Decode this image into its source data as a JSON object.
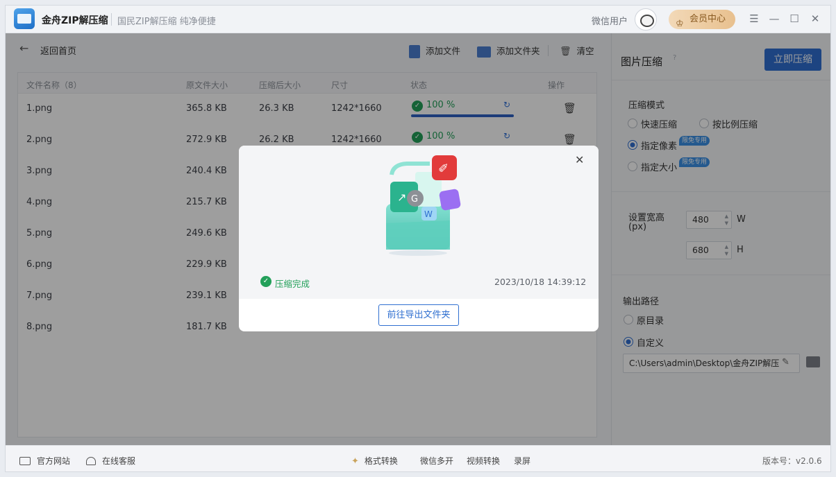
{
  "app": {
    "title": "金舟ZIP解压缩",
    "subtitle": "国民ZIP解压缩  纯净便捷",
    "user_name": "微信用户",
    "vip_label": "会员中心"
  },
  "window_controls": {
    "menu": "☰",
    "minimize": "—",
    "maximize": "☐",
    "close": "✕"
  },
  "toolbar": {
    "back_label": "返回首页",
    "add_file": "添加文件",
    "add_folder": "添加文件夹",
    "clear": "清空"
  },
  "table": {
    "headers": [
      "文件名称（8）",
      "原文件大小",
      "压缩后大小",
      "尺寸",
      "状态",
      "操作"
    ],
    "rows": [
      {
        "name": "1.png",
        "orig": "365.8 KB",
        "comp": "26.3 KB",
        "dim": "1242*1660",
        "progress": 1.0,
        "pct_text": "100 %"
      },
      {
        "name": "2.png",
        "orig": "272.9 KB",
        "comp": "26.2 KB",
        "dim": "1242*1660",
        "progress": 1.0,
        "pct_text": "100 %"
      },
      {
        "name": "3.png",
        "orig": "240.4 KB"
      },
      {
        "name": "4.png",
        "orig": "215.7 KB"
      },
      {
        "name": "5.png",
        "orig": "249.6 KB"
      },
      {
        "name": "6.png",
        "orig": "229.9 KB"
      },
      {
        "name": "7.png",
        "orig": "239.1 KB"
      },
      {
        "name": "8.png",
        "orig": "181.7 KB"
      }
    ]
  },
  "settings": {
    "title": "图片压缩",
    "help": "?",
    "compress_button": "立即压缩",
    "mode_label": "压缩模式",
    "mode_options": [
      "快速压缩",
      "按比例压缩",
      "指定像素",
      "指定大小"
    ],
    "mode_selected": "指定像素",
    "vip_badge": "限免专用",
    "size_label_1": "设置宽高",
    "size_label_2": "(px)",
    "width": "480",
    "height": "680",
    "width_unit": "W",
    "height_unit": "H",
    "output_label": "输出路径",
    "output_options": [
      "原目录",
      "自定义"
    ],
    "output_selected": "自定义",
    "output_path": "C:\\Users\\admin\\Desktop\\金舟ZIP解压"
  },
  "modal": {
    "status_text": "压缩完成",
    "timestamp": "2023/10/18 14:39:12",
    "open_folder_button": "前往导出文件夹",
    "close": "✕"
  },
  "footer": {
    "website": "官方网站",
    "support": "在线客服",
    "links": [
      "格式转换",
      "微信多开",
      "视频转换",
      "录屏"
    ],
    "version": "版本号：v2.0.6"
  },
  "colors": {
    "primary": "#2f6fd0",
    "success": "#23a05a",
    "vip": "#e8c08e"
  }
}
